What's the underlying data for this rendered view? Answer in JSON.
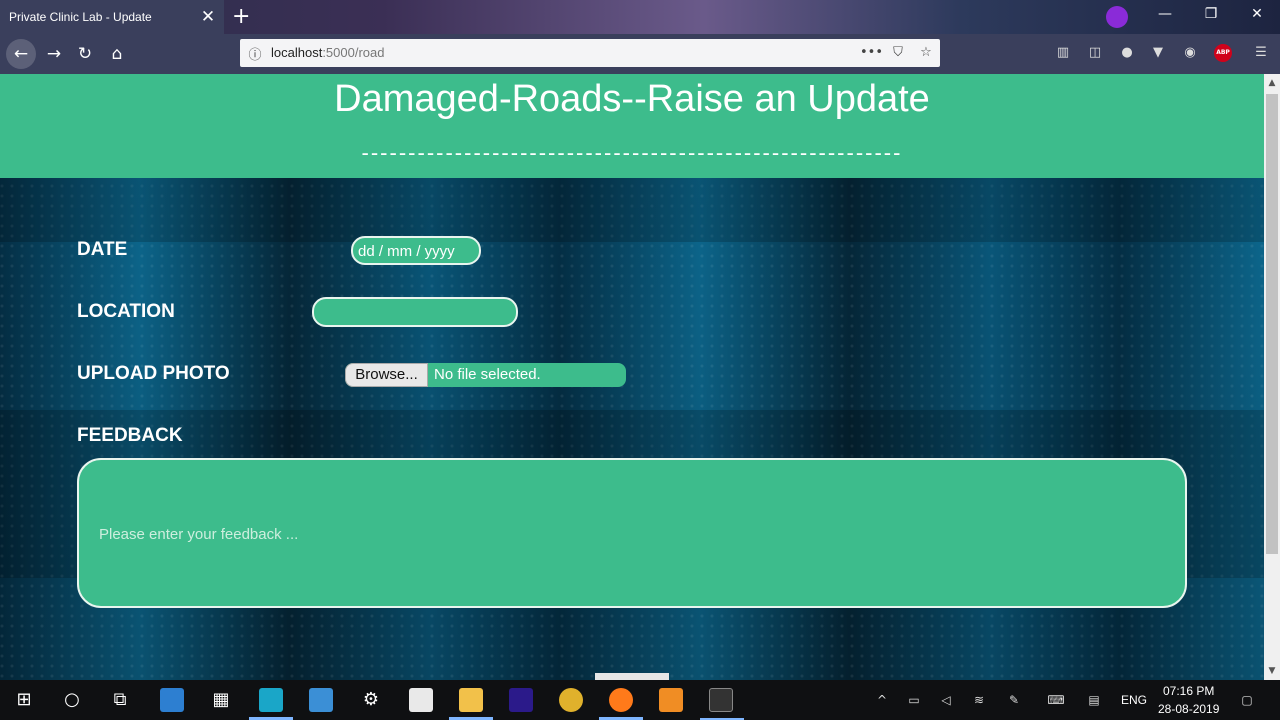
{
  "browser": {
    "tab_title": "Private Clinic Lab - Update",
    "url_host": "localhost",
    "url_path": ":5000/road",
    "icons": [
      "close-icon",
      "plus-icon",
      "back-icon",
      "forward-icon",
      "reload-icon",
      "home-icon",
      "info-icon",
      "more-icon",
      "pocket-icon",
      "star-icon",
      "library-icon",
      "sidebar-icon",
      "account-icon",
      "menu-icon"
    ],
    "abp_label": "ABP"
  },
  "page": {
    "title": "Damaged-Roads--Raise an Update",
    "divider": "----------------------------------------------------------",
    "date_label": "DATE",
    "date_placeholder": "dd / mm / yyyy",
    "location_label": "LOCATION",
    "location_value": "",
    "upload_label": "UPLOAD PHOTO",
    "browse_label": "Browse...",
    "no_file_text": "No file selected.",
    "feedback_label": "FEEDBACK",
    "feedback_placeholder": "Please enter your feedback ...",
    "accent_color": "#3dbc8c"
  },
  "taskbar": {
    "language": "ENG",
    "time": "07:16 PM",
    "date": "28-08-2019",
    "apps": [
      "windows-start",
      "cortana",
      "task-view",
      "file-explorer",
      "calculator",
      "whatsapp",
      "news",
      "settings",
      "store",
      "folder",
      "amazon-music",
      "chrome",
      "firefox",
      "sublime-text",
      "terminal"
    ]
  }
}
